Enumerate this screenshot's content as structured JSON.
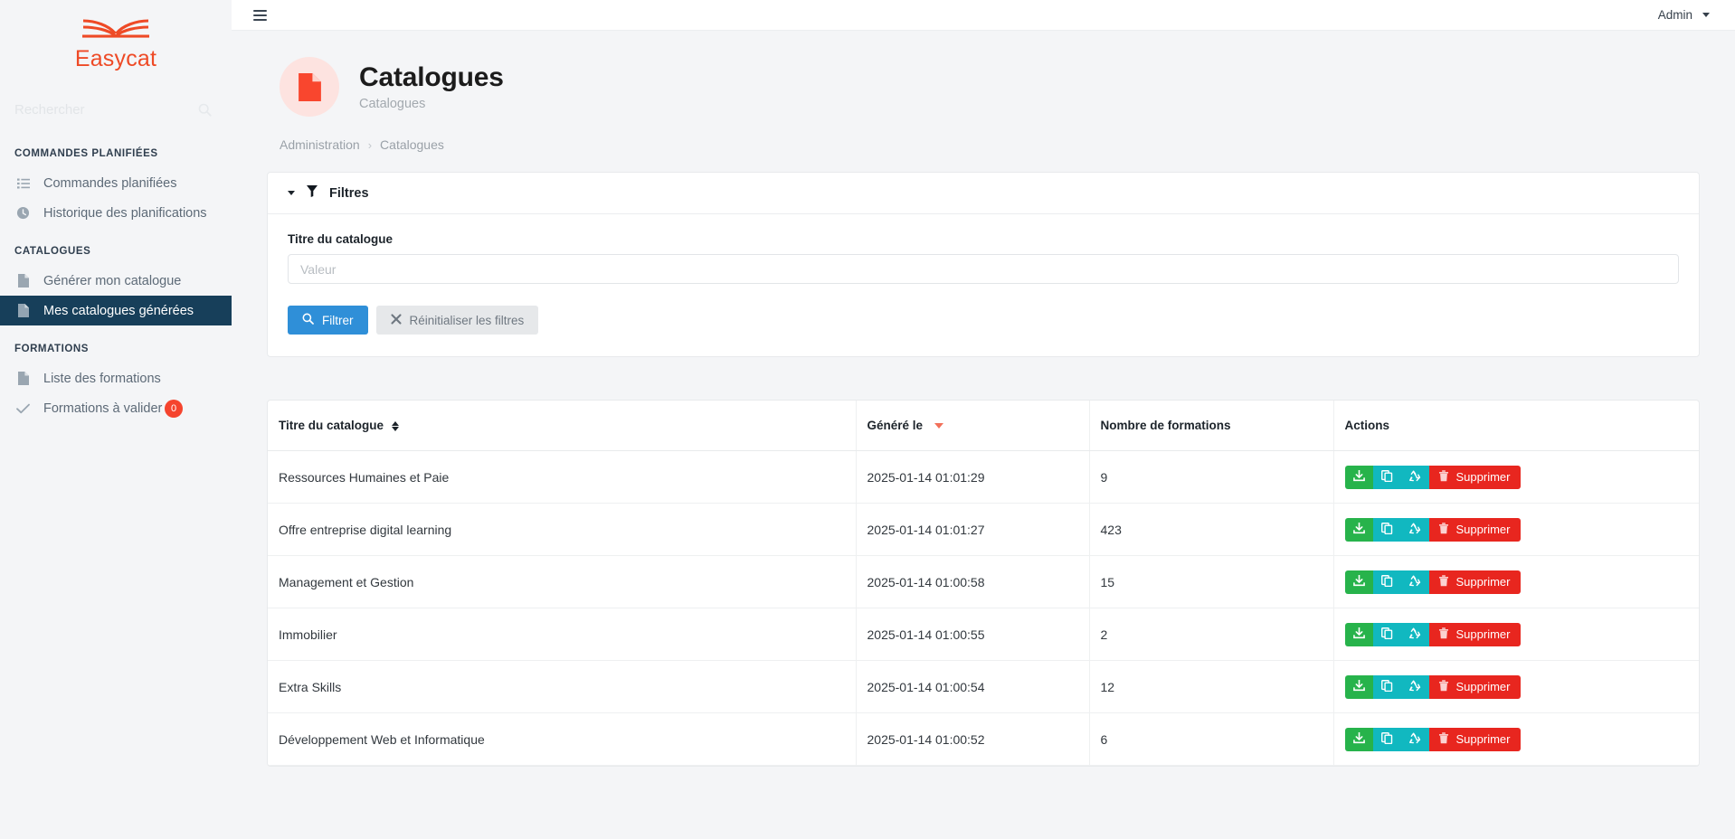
{
  "brand": {
    "name": "Easycat",
    "logo_icon": "open-book-icon",
    "color": "#ee4a26"
  },
  "sidebar": {
    "search": {
      "placeholder": "Rechercher",
      "value": "",
      "icon": "search-icon"
    },
    "sections": [
      {
        "title": "COMMANDES PLANIFIÉES",
        "items": [
          {
            "label": "Commandes planifiées",
            "icon": "list-icon",
            "active": false,
            "badge": null
          },
          {
            "label": "Historique des planifications",
            "icon": "clock-icon",
            "active": false,
            "badge": null
          }
        ]
      },
      {
        "title": "CATALOGUES",
        "items": [
          {
            "label": "Générer mon catalogue",
            "icon": "file-icon",
            "active": false,
            "badge": null
          },
          {
            "label": "Mes catalogues générées",
            "icon": "file-icon",
            "active": true,
            "badge": null
          }
        ]
      },
      {
        "title": "FORMATIONS",
        "items": [
          {
            "label": "Liste des formations",
            "icon": "file-icon",
            "active": false,
            "badge": null
          },
          {
            "label": "Formations à valider",
            "icon": "check-icon",
            "active": false,
            "badge": "0"
          }
        ]
      }
    ],
    "active_bg": "#173f5a",
    "badge_color": "#f5442e"
  },
  "topbar": {
    "menu_toggle_icon": "hamburger-icon",
    "user_label": "Admin",
    "user_caret_icon": "chevron-down-icon"
  },
  "page": {
    "icon": "document-icon",
    "title": "Catalogues",
    "subtitle": "Catalogues",
    "icon_circle_color": "#fde3e0",
    "icon_color": "#f9462e"
  },
  "breadcrumb": {
    "items": [
      "Administration",
      "Catalogues"
    ],
    "separator": "›"
  },
  "filters": {
    "header_label": "Filtres",
    "header_icon": "funnel-icon",
    "collapse_icon": "caret-down-icon",
    "field_label": "Titre du catalogue",
    "field_placeholder": "Valeur",
    "field_value": "",
    "submit_label": "Filtrer",
    "submit_icon": "search-icon",
    "reset_label": "Réinitialiser les filtres",
    "reset_icon": "times-icon",
    "primary_color": "#2f8fd8"
  },
  "table": {
    "columns": [
      {
        "label": "Titre du catalogue",
        "sort": "both"
      },
      {
        "label": "Généré le",
        "sort": "desc"
      },
      {
        "label": "Nombre de formations",
        "sort": "none"
      },
      {
        "label": "Actions",
        "sort": "none"
      }
    ],
    "row_actions": {
      "download_label": "",
      "download_icon": "download-icon",
      "copy_label": "",
      "copy_icon": "copy-icon",
      "regenerate_label": "",
      "regenerate_icon": "recycle-icon",
      "delete_label": "Supprimer",
      "delete_icon": "trash-icon",
      "download_color": "#27b34b",
      "copy_color": "#11b8c0",
      "delete_color": "#e8261f"
    },
    "rows": [
      {
        "title": "Ressources Humaines et Paie",
        "generated_at": "2025-01-14 01:01:29",
        "count": "9"
      },
      {
        "title": "Offre entreprise digital learning",
        "generated_at": "2025-01-14 01:01:27",
        "count": "423"
      },
      {
        "title": "Management et Gestion",
        "generated_at": "2025-01-14 01:00:58",
        "count": "15"
      },
      {
        "title": "Immobilier",
        "generated_at": "2025-01-14 01:00:55",
        "count": "2"
      },
      {
        "title": "Extra Skills",
        "generated_at": "2025-01-14 01:00:54",
        "count": "12"
      },
      {
        "title": "Développement Web et Informatique",
        "generated_at": "2025-01-14 01:00:52",
        "count": "6"
      }
    ]
  }
}
